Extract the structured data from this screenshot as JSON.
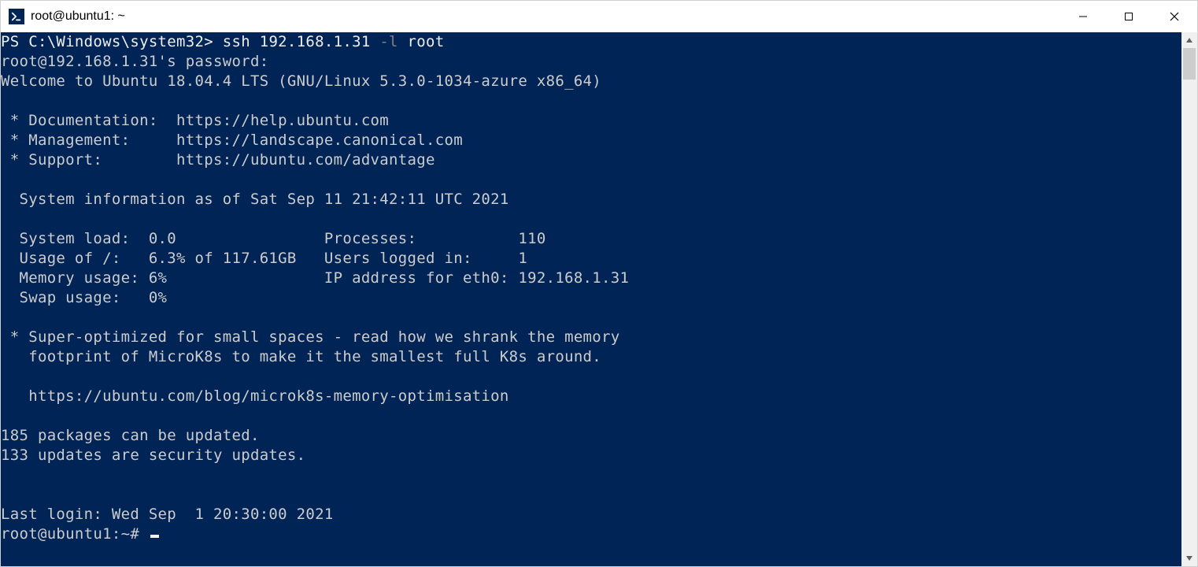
{
  "window": {
    "title": "root@ubuntu1: ~"
  },
  "colors": {
    "terminal_bg": "#012456",
    "terminal_fg": "#cccccc",
    "ps_prompt": "#f0f0f0",
    "ssh_cmd": "#eeedf0",
    "ssh_flag": "#808080"
  },
  "terminal": {
    "lines": [
      [
        {
          "cls": "c-white",
          "text": "PS C:\\Windows\\system32> "
        },
        {
          "cls": "c-yellow",
          "text": "ssh 192.168.1.31 "
        },
        {
          "cls": "c-gray",
          "text": "-l "
        },
        {
          "cls": "c-yellow",
          "text": "root"
        }
      ],
      [
        {
          "cls": "c-default",
          "text": "root@192.168.1.31's password:"
        }
      ],
      [
        {
          "cls": "c-default",
          "text": "Welcome to Ubuntu 18.04.4 LTS (GNU/Linux 5.3.0-1034-azure x86_64)"
        }
      ],
      [
        {
          "cls": "c-default",
          "text": ""
        }
      ],
      [
        {
          "cls": "c-default",
          "text": " * Documentation:  https://help.ubuntu.com"
        }
      ],
      [
        {
          "cls": "c-default",
          "text": " * Management:     https://landscape.canonical.com"
        }
      ],
      [
        {
          "cls": "c-default",
          "text": " * Support:        https://ubuntu.com/advantage"
        }
      ],
      [
        {
          "cls": "c-default",
          "text": ""
        }
      ],
      [
        {
          "cls": "c-default",
          "text": "  System information as of Sat Sep 11 21:42:11 UTC 2021"
        }
      ],
      [
        {
          "cls": "c-default",
          "text": ""
        }
      ],
      [
        {
          "cls": "c-default",
          "text": "  System load:  0.0                Processes:           110"
        }
      ],
      [
        {
          "cls": "c-default",
          "text": "  Usage of /:   6.3% of 117.61GB   Users logged in:     1"
        }
      ],
      [
        {
          "cls": "c-default",
          "text": "  Memory usage: 6%                 IP address for eth0: 192.168.1.31"
        }
      ],
      [
        {
          "cls": "c-default",
          "text": "  Swap usage:   0%"
        }
      ],
      [
        {
          "cls": "c-default",
          "text": ""
        }
      ],
      [
        {
          "cls": "c-default",
          "text": " * Super-optimized for small spaces - read how we shrank the memory"
        }
      ],
      [
        {
          "cls": "c-default",
          "text": "   footprint of MicroK8s to make it the smallest full K8s around."
        }
      ],
      [
        {
          "cls": "c-default",
          "text": ""
        }
      ],
      [
        {
          "cls": "c-default",
          "text": "   https://ubuntu.com/blog/microk8s-memory-optimisation"
        }
      ],
      [
        {
          "cls": "c-default",
          "text": ""
        }
      ],
      [
        {
          "cls": "c-default",
          "text": "185 packages can be updated."
        }
      ],
      [
        {
          "cls": "c-default",
          "text": "133 updates are security updates."
        }
      ],
      [
        {
          "cls": "c-default",
          "text": ""
        }
      ],
      [
        {
          "cls": "c-default",
          "text": ""
        }
      ],
      [
        {
          "cls": "c-default",
          "text": "Last login: Wed Sep  1 20:30:00 2021"
        }
      ],
      [
        {
          "cls": "c-default",
          "text": "root@ubuntu1:~# ",
          "cursor": true
        }
      ]
    ]
  }
}
